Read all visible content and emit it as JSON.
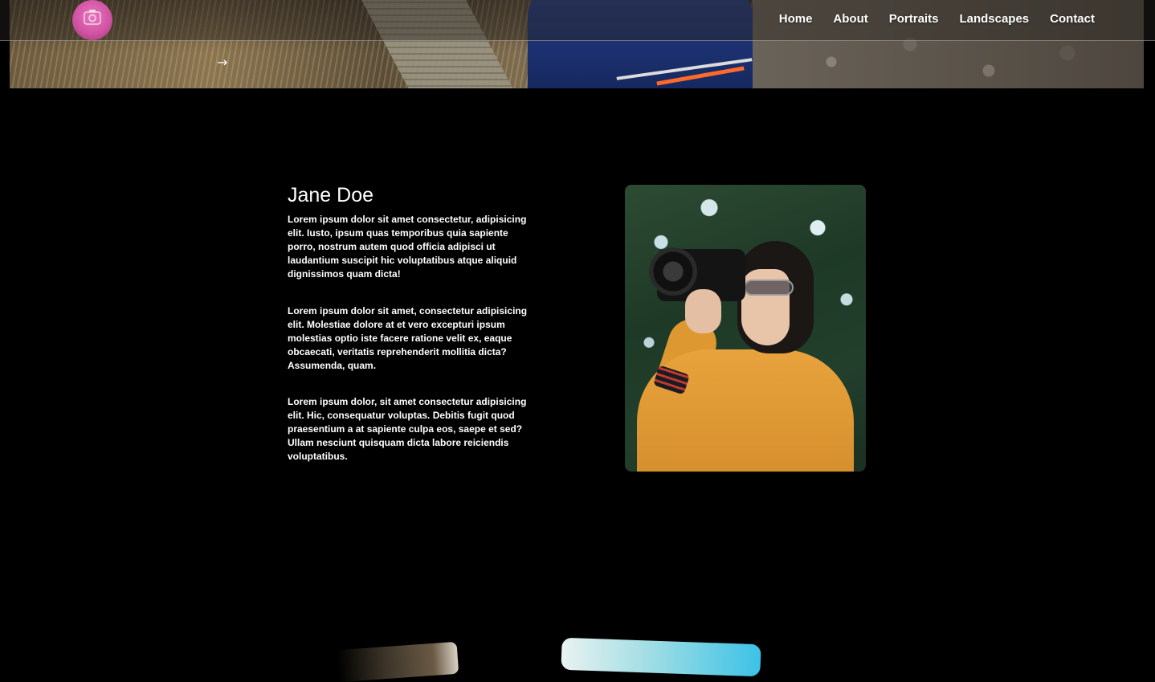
{
  "nav": {
    "logo_icon": "camera-icon",
    "links": [
      {
        "label": "Home"
      },
      {
        "label": "About"
      },
      {
        "label": "Portraits"
      },
      {
        "label": "Landscapes"
      },
      {
        "label": "Contact"
      }
    ]
  },
  "hero": {
    "arrow": "→"
  },
  "about": {
    "name": "Jane Doe",
    "paragraphs": [
      "Lorem ipsum dolor sit amet consectetur, adipisicing elit. Iusto, ipsum quas temporibus quia sapiente porro, nostrum autem quod officia adipisci ut laudantium suscipit hic voluptatibus atque aliquid dignissimos quam dicta!",
      "Lorem ipsum dolor sit amet, consectetur adipisicing elit. Molestiae dolore at et vero excepturi ipsum molestias optio iste facere ratione velit ex, eaque obcaecati, veritatis reprehenderit mollitia dicta? Assumenda, quam.",
      "Lorem ipsum dolor, sit amet consectetur adipisicing elit. Hic, consequatur voluptas. Debitis fugit quod praesentium a at sapiente culpa eos, saepe et sed? Ullam nesciunt quisquam dicta labore reiciendis voluptatibus."
    ]
  },
  "colors": {
    "background": "#000000",
    "logo_accent": "#e057b0",
    "text": "#ffffff"
  }
}
